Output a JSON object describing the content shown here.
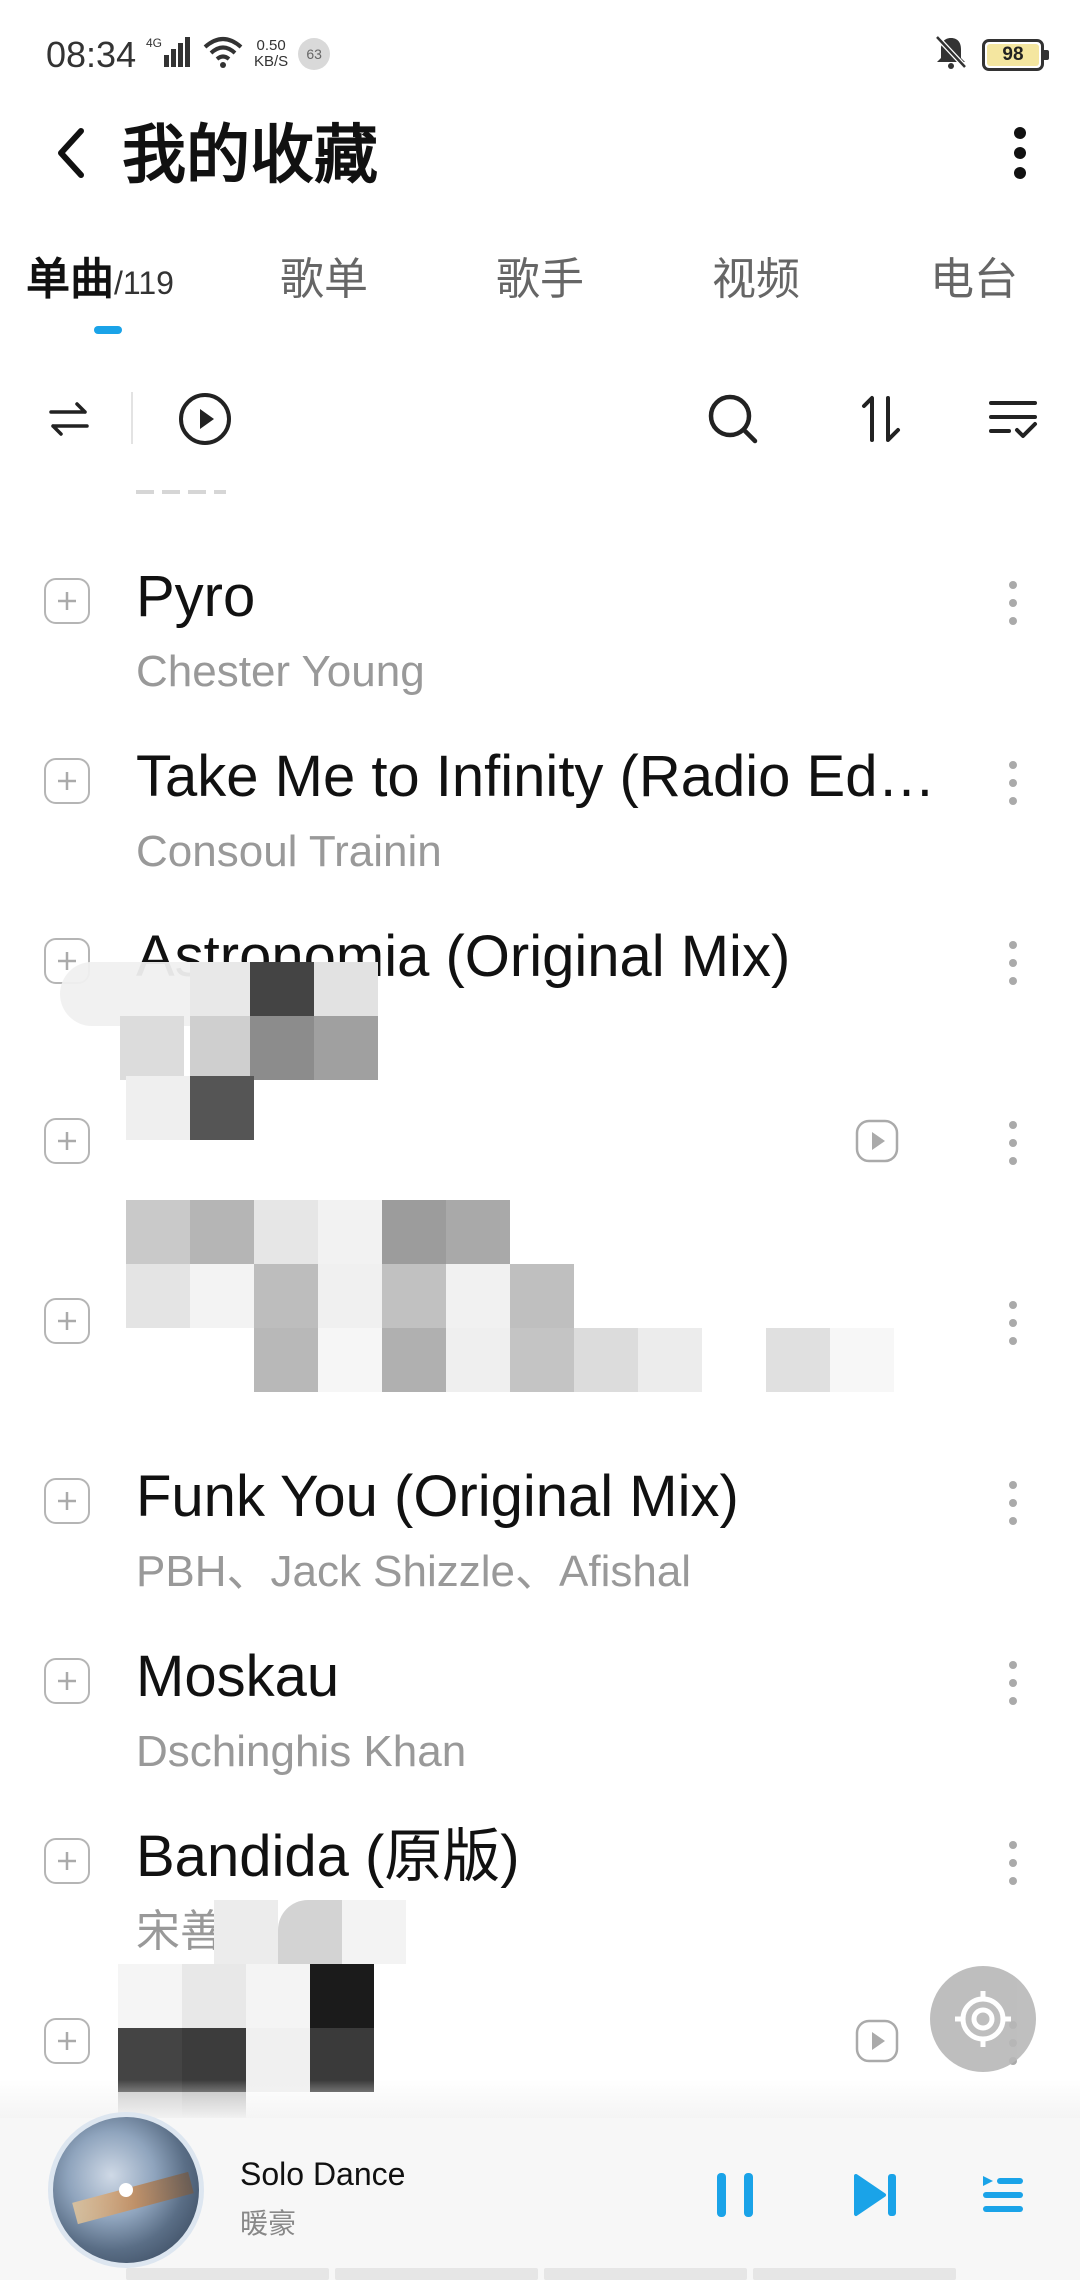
{
  "status_bar": {
    "time": "08:34",
    "network": "4G",
    "speed_value": "0.50",
    "speed_unit": "KB/S",
    "notification_count": "63",
    "battery": "98"
  },
  "header": {
    "title": "我的收藏"
  },
  "tabs": [
    {
      "label": "单曲",
      "count": "/119",
      "active": true
    },
    {
      "label": "歌单"
    },
    {
      "label": "歌手"
    },
    {
      "label": "视频"
    },
    {
      "label": "电台"
    }
  ],
  "songs": [
    {
      "title": "Pyro",
      "artist": "Chester Young",
      "has_mv": false
    },
    {
      "title": "Take Me to Infinity (Radio Ed…",
      "artist": "Consoul Trainin",
      "has_mv": false
    },
    {
      "title": "Astronomia (Original Mix)",
      "artist": "",
      "has_mv": false
    },
    {
      "title": "",
      "artist": "",
      "has_mv": true
    },
    {
      "title": "",
      "artist": "",
      "has_mv": false
    },
    {
      "title": "Funk You (Original Mix)",
      "artist": "PBH、Jack Shizzle、Afishal",
      "has_mv": false
    },
    {
      "title": "Moskau",
      "artist": "Dschinghis Khan",
      "has_mv": false
    },
    {
      "title": "Bandida (原版)",
      "artist": "宋善恩",
      "has_mv": false
    },
    {
      "title": "",
      "artist": "",
      "has_mv": true
    }
  ],
  "now_playing": {
    "title": "Solo Dance",
    "artist": "暖豪",
    "state": "playing"
  },
  "colors": {
    "accent": "#1aa3e8",
    "title_text": "#111111",
    "secondary_text": "#999999"
  },
  "icons": {
    "back": "chevron-left-icon",
    "more": "more-vertical-icon",
    "shuffle": "shuffle-icon",
    "play_all": "play-circle-icon",
    "search": "search-icon",
    "sort": "sort-icon",
    "multi_select": "list-check-icon",
    "add": "plus-box-icon",
    "mv": "video-play-icon",
    "pause": "pause-icon",
    "next": "skip-next-icon",
    "playlist": "playlist-icon"
  }
}
